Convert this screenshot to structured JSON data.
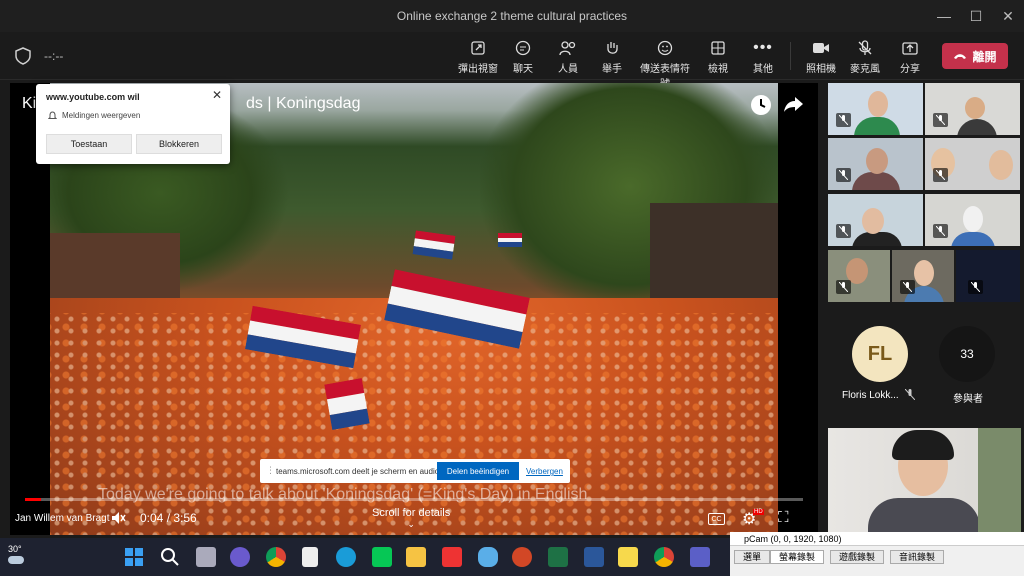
{
  "window": {
    "title": "Online exchange 2 theme cultural practices",
    "minimize": "—",
    "maximize": "☐",
    "close": "✕"
  },
  "toolbar": {
    "timer": "--:--",
    "buttons": [
      {
        "label": "彈出視窗",
        "icon": "popout-icon"
      },
      {
        "label": "聊天",
        "icon": "chat-icon"
      },
      {
        "label": "人員",
        "icon": "people-icon"
      },
      {
        "label": "舉手",
        "icon": "raise-hand-icon"
      },
      {
        "label": "傳送表情符號",
        "icon": "emoji-icon"
      },
      {
        "label": "檢視",
        "icon": "view-icon"
      },
      {
        "label": "其他",
        "icon": "more-icon"
      },
      {
        "label": "照相機",
        "icon": "camera-icon"
      },
      {
        "label": "麥克風",
        "icon": "mic-off-icon"
      },
      {
        "label": "分享",
        "icon": "share-icon"
      }
    ],
    "leave_label": "離開"
  },
  "video": {
    "title_prefix": "Ki",
    "title_suffix": "ds | Koningsdag",
    "caption": "Today we're going to talk about 'Koningsdag' (=King's Day) in English",
    "presenter": "Jan Willem van Bragt",
    "time": "0:04 / 3:56",
    "progress": 0.02,
    "scroll_hint": "Scroll for details",
    "cc": "CC",
    "hd": "HD"
  },
  "notification": {
    "site": "www.youtube.com wil",
    "message": "Meldingen weergeven",
    "allow": "Toestaan",
    "block": "Blokkeren"
  },
  "share_bar": {
    "text": "teams.microsoft.com deelt je scherm en audio.",
    "stop": "Delen beëindigen",
    "hide": "Verbergen"
  },
  "participants": {
    "floris_initials": "FL",
    "floris_name": "Floris Lokk...",
    "count": "33",
    "count_label": "參與者"
  },
  "taskbar": {
    "weather": "30°"
  },
  "obs": {
    "header": "pCam (0, 0, 1920, 1080)",
    "tabs": [
      "選單",
      "螢幕錄製",
      "遊戲錄製",
      "音訊錄製"
    ]
  },
  "colors": {
    "leave": "#c4314b",
    "accent": "#0067c0",
    "flag_red": "#c8102e",
    "flag_blue": "#21468b"
  }
}
